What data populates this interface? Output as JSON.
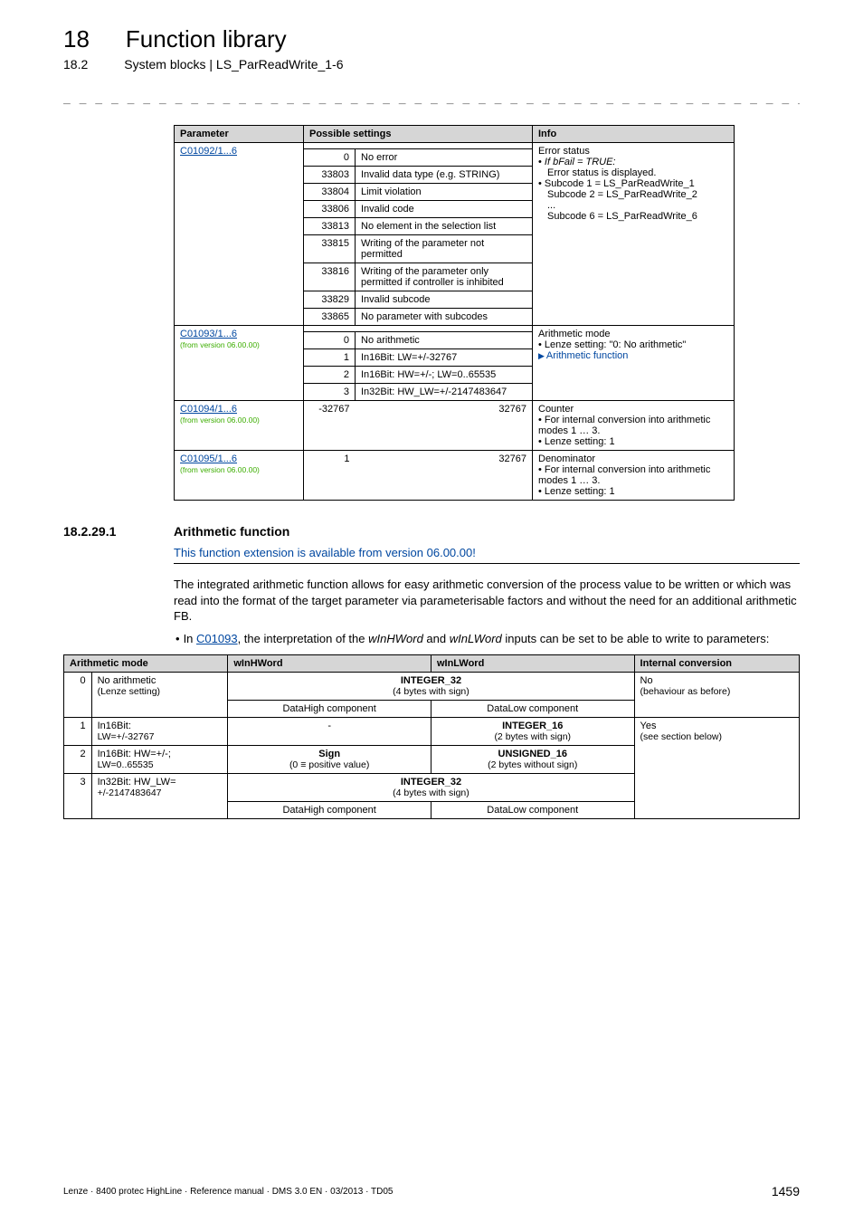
{
  "header": {
    "chapter_num": "18",
    "chapter_title": "Function library",
    "sub_num": "18.2",
    "sub_title": "System blocks | LS_ParReadWrite_1-6",
    "dashes": "_ _ _ _ _ _ _ _ _ _ _ _ _ _ _ _ _ _ _ _ _ _ _ _ _ _ _ _ _ _ _ _ _ _ _ _ _ _ _ _ _ _ _ _ _ _ _ _ _ _ _ _ _ _ _ _ _ _ _ _ _ _ _ _"
  },
  "table1": {
    "headers": {
      "param": "Parameter",
      "settings": "Possible settings",
      "info": "Info"
    },
    "rows": {
      "c1092": {
        "link": "C01092/1...6",
        "info_title": "Error status",
        "info_b1": "If bFail = TRUE:",
        "info_b1_sub": "Error status is displayed.",
        "info_b2": "Subcode 1 = LS_ParReadWrite_1",
        "info_b3": "Subcode 2 = LS_ParReadWrite_2",
        "info_dots": "...",
        "info_b4": "Subcode 6 = LS_ParReadWrite_6",
        "s0n": "0",
        "s0v": "No error",
        "s1n": "33803",
        "s1v": "Invalid data type (e.g. STRING)",
        "s2n": "33804",
        "s2v": "Limit violation",
        "s3n": "33806",
        "s3v": "Invalid code",
        "s4n": "33813",
        "s4v": "No element in the selection list",
        "s5n": "33815",
        "s5v": "Writing of the parameter not permitted",
        "s6n": "33816",
        "s6v": "Writing of the parameter only permitted if controller is inhibited",
        "s7n": "33829",
        "s7v": "Invalid subcode",
        "s8n": "33865",
        "s8v": "No parameter with subcodes"
      },
      "c1093": {
        "link": "C01093/1...6",
        "ver": "(from version 06.00.00)",
        "info_title": "Arithmetic mode",
        "info_b1": "Lenze setting: \"0: No arithmetic\"",
        "info_link": "Arithmetic function",
        "s0n": "0",
        "s0v": "No arithmetic",
        "s1n": "1",
        "s1v": "In16Bit: LW=+/-32767",
        "s2n": "2",
        "s2v": "In16Bit: HW=+/-; LW=0..65535",
        "s3n": "3",
        "s3v": "In32Bit: HW_LW=+/-2147483647"
      },
      "c1094": {
        "link": "C01094/1...6",
        "ver": "(from version 06.00.00)",
        "lo": "-32767",
        "hi": "32767",
        "info_title": "Counter",
        "info_b1": "For internal conversion into arithmetic modes 1 … 3.",
        "info_b2": "Lenze setting: 1"
      },
      "c1095": {
        "link": "C01095/1...6",
        "ver": "(from version 06.00.00)",
        "lo": "1",
        "hi": "32767",
        "info_title": "Denominator",
        "info_b1": "For internal conversion into arithmetic modes 1 … 3.",
        "info_b2": "Lenze setting: 1"
      }
    }
  },
  "section": {
    "num": "18.2.29.1",
    "title": "Arithmetic function",
    "version_note": "This function extension is available from version 06.00.00!",
    "para": "The integrated arithmetic function allows for easy arithmetic conversion of the process value to be written or which was read into the format of the target parameter via parameterisable factors and without the need for an additional arithmetic FB.",
    "bullet_pre": "In ",
    "bullet_link": "C01093",
    "bullet_post": ", the interpretation of the wInHWord and wInLWord inputs can be set to be able to write to parameters:"
  },
  "table2": {
    "headers": {
      "mode": "Arithmetic mode",
      "hw": "wInHWord",
      "lw": "wInLWord",
      "conv": "Internal conversion"
    },
    "r0": {
      "idx": "0",
      "mode": "No arithmetic",
      "mode2": "(Lenze setting)",
      "int": "INTEGER_32",
      "int2": "(4 bytes with sign)",
      "dh": "DataHigh component",
      "dl": "DataLow component",
      "conv": "No",
      "conv2": "(behaviour as before)"
    },
    "r1": {
      "idx": "1",
      "mode": "In16Bit:",
      "mode2": "LW=+/-32767",
      "hw": "-",
      "lw": "INTEGER_16",
      "lw2": "(2 bytes with sign)",
      "conv": "Yes",
      "conv2": "(see section below)"
    },
    "r2": {
      "idx": "2",
      "mode": "In16Bit: HW=+/-;",
      "mode2": "LW=0..65535",
      "hw": "Sign",
      "hw2": "(0 ≡ positive value)",
      "lw": "UNSIGNED_16",
      "lw2": "(2 bytes without sign)"
    },
    "r3": {
      "idx": "3",
      "mode": "In32Bit: HW_LW=",
      "mode2": "+/-2147483647",
      "int": "INTEGER_32",
      "int2": "(4 bytes with sign)",
      "dh": "DataHigh component",
      "dl": "DataLow component"
    }
  },
  "footer": {
    "text": "Lenze · 8400 protec HighLine · Reference manual · DMS 3.0 EN · 03/2013 · TD05",
    "page": "1459"
  }
}
